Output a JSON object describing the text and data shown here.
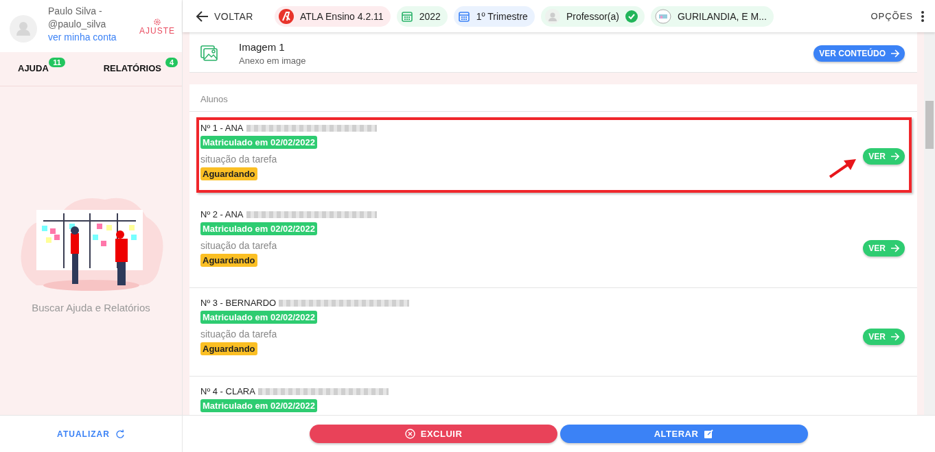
{
  "user": {
    "name": "Paulo Silva -",
    "handle": "@paulo_silva",
    "account_link": "ver minha conta",
    "settings_label": "AJUSTE"
  },
  "sidebar_tabs": [
    {
      "label": "AJUDA",
      "count": "11",
      "selected": false
    },
    {
      "label": "RELATÓRIOS",
      "count": "4",
      "selected": false
    }
  ],
  "sidebar_caption": "Buscar Ajuda e Relatórios",
  "refresh_label": "ATUALIZAR",
  "topbar": {
    "back": "VOLTAR",
    "chips": [
      {
        "kind": "app",
        "label": "ATLA Ensino 4.2.11"
      },
      {
        "kind": "year",
        "label": "2022"
      },
      {
        "kind": "term",
        "label": "1º Trimestre"
      },
      {
        "kind": "role",
        "label": "Professor(a)"
      },
      {
        "kind": "school",
        "label": "GURILANDIA, E M..."
      }
    ],
    "options": "OPÇÕES"
  },
  "attachment": {
    "title": "Imagem 1",
    "subtitle": "Anexo em image",
    "button": "VER CONTEÚDO"
  },
  "students_header": "Alunos",
  "students": [
    {
      "name": "Nº 1 - ANA",
      "enrolled": "Matriculado em 02/02/2022",
      "status_label": "situação da tarefa",
      "status": "Aguardando",
      "button": "VER",
      "highlighted": true
    },
    {
      "name": "Nº 2 - ANA",
      "enrolled": "Matriculado em 02/02/2022",
      "status_label": "situação da tarefa",
      "status": "Aguardando",
      "button": "VER",
      "highlighted": false
    },
    {
      "name": "Nº 3 - BERNARDO",
      "enrolled": "Matriculado em 02/02/2022",
      "status_label": "situação da tarefa",
      "status": "Aguardando",
      "button": "VER",
      "highlighted": false
    },
    {
      "name": "Nº 4 - CLARA",
      "enrolled": "Matriculado em 02/02/2022",
      "highlighted": false
    }
  ],
  "actions": {
    "delete": "EXCLUIR",
    "edit": "ALTERAR"
  }
}
